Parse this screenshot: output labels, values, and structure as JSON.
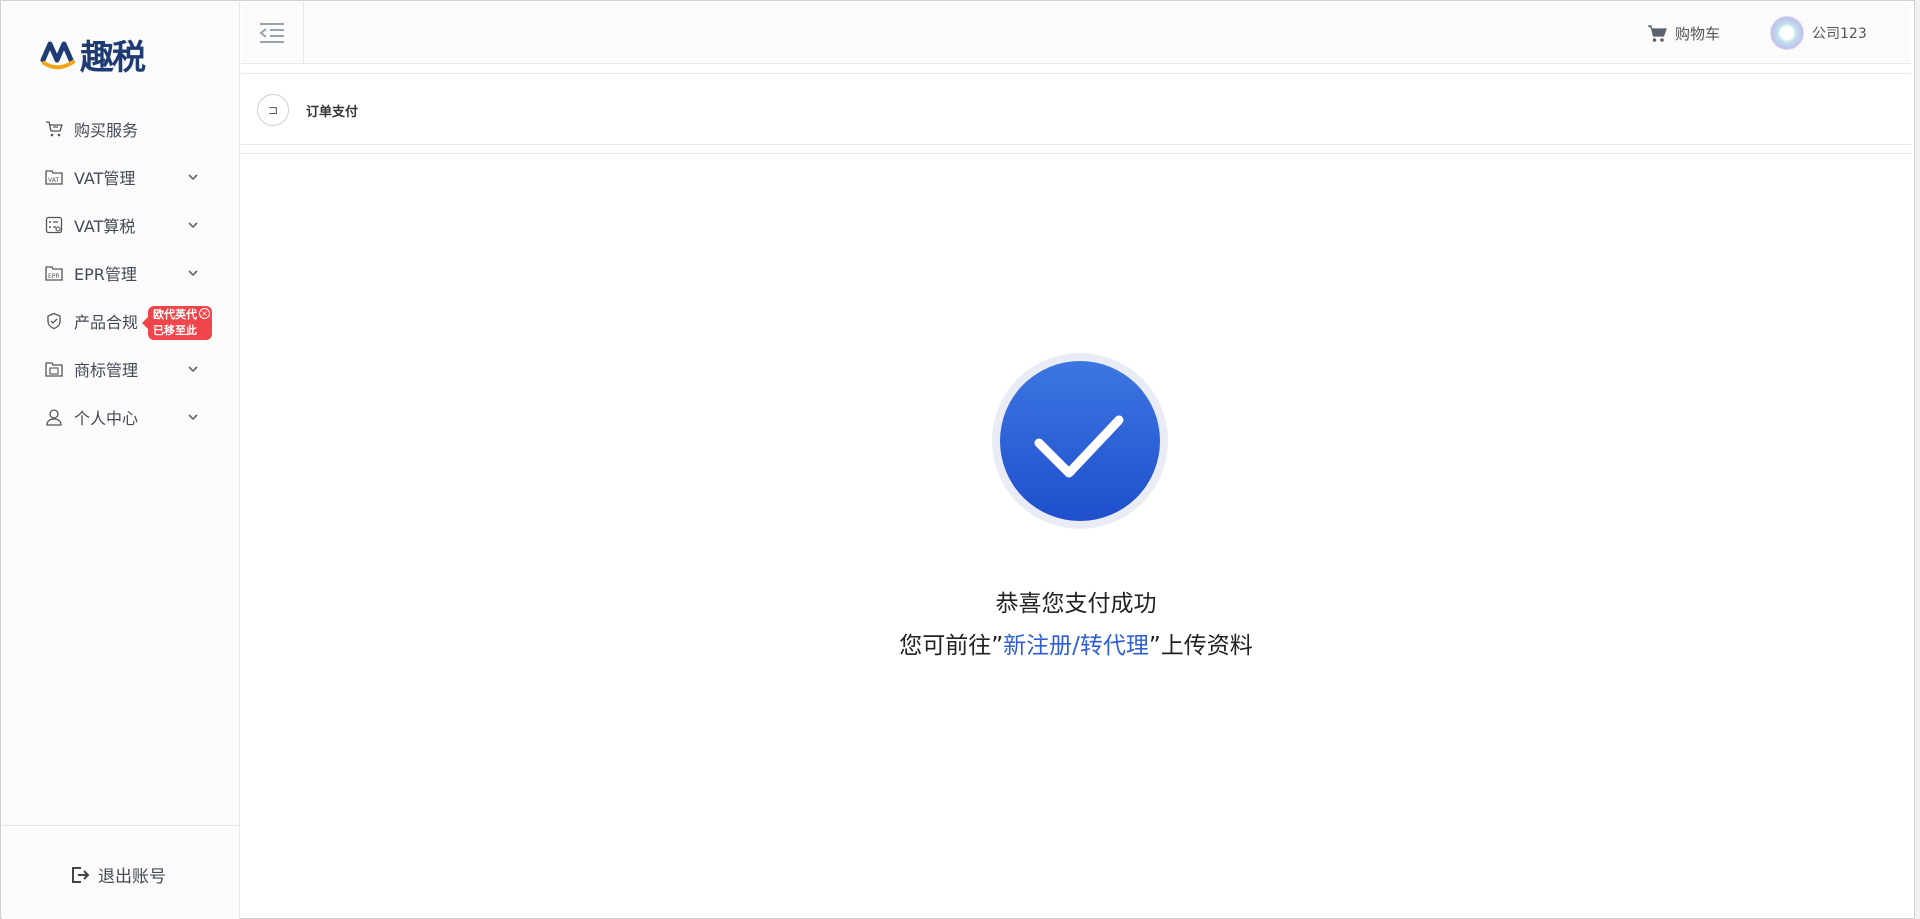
{
  "brand": {
    "logo_text": "趣税"
  },
  "sidebar": {
    "items": [
      {
        "label": "购买服务",
        "icon": "cart-icon",
        "expandable": false
      },
      {
        "label": "VAT管理",
        "icon": "vat-folder-icon",
        "expandable": true
      },
      {
        "label": "VAT算税",
        "icon": "calculator-icon",
        "expandable": true
      },
      {
        "label": "EPR管理",
        "icon": "epr-folder-icon",
        "expandable": true
      },
      {
        "label": "产品合规",
        "icon": "shield-check-icon",
        "expandable": false,
        "badge": {
          "line1": "欧代英代",
          "line2": "已移至此"
        }
      },
      {
        "label": "商标管理",
        "icon": "trademark-folder-icon",
        "expandable": true
      },
      {
        "label": "个人中心",
        "icon": "user-icon",
        "expandable": true
      }
    ],
    "logout_label": "退出账号"
  },
  "header": {
    "cart_label": "购物车",
    "user_name": "公司123"
  },
  "breadcrumb": {
    "back_glyph": "⊐",
    "title": "订单支付"
  },
  "main": {
    "success_title": "恭喜您支付成功",
    "instruction_prefix": "您可前往”",
    "instruction_link": "新注册/转代理",
    "instruction_suffix": "”上传资料"
  },
  "colors": {
    "accent": "#2f5ed6",
    "success_circle": "#2a5ed9",
    "badge": "#f0454a"
  }
}
